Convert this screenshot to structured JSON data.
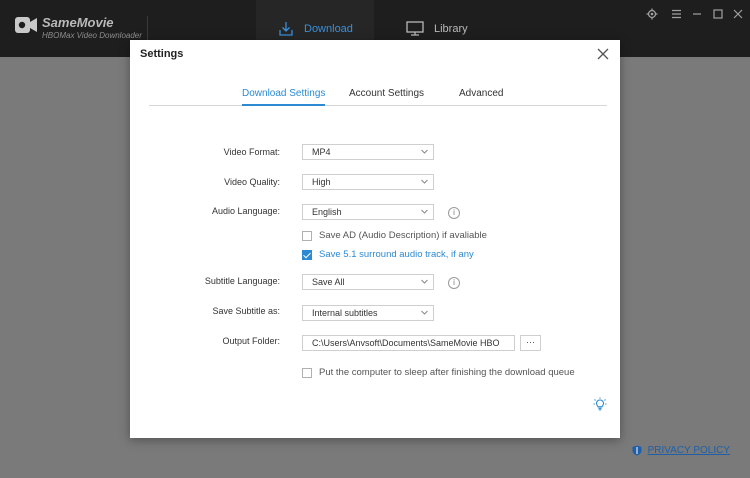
{
  "app": {
    "name": "SameMovie",
    "subtitle": "HBOMax Video Downloader"
  },
  "nav": {
    "download_label": "Download",
    "library_label": "Library"
  },
  "footer": {
    "privacy_label": "PRIVACY POLICY"
  },
  "dialog": {
    "title": "Settings",
    "tabs": [
      "Download Settings",
      "Account Settings",
      "Advanced"
    ],
    "active_tab": "Download Settings",
    "fields": {
      "video_format": {
        "label": "Video Format:",
        "value": "MP4"
      },
      "video_quality": {
        "label": "Video Quality:",
        "value": "High"
      },
      "audio_language": {
        "label": "Audio Language:",
        "value": "English"
      },
      "save_ad": {
        "label": "Save AD (Audio Description) if avaliable",
        "checked": false
      },
      "save_51": {
        "label": "Save 5.1 surround audio track, if any",
        "checked": true
      },
      "subtitle_language": {
        "label": "Subtitle Language:",
        "value": "Save All"
      },
      "save_subtitle_as": {
        "label": "Save Subtitle as:",
        "value": "Internal subtitles"
      },
      "output_folder": {
        "label": "Output Folder:",
        "value": "C:\\Users\\Anvsoft\\Documents\\SameMovie HBO",
        "browse_label": "···"
      },
      "sleep": {
        "label": "Put the computer to sleep after finishing the download queue",
        "checked": false
      }
    }
  },
  "colors": {
    "accent": "#2c8ad3",
    "titlebar": "#1e1e1e",
    "overlay": "#7a7a7a"
  }
}
